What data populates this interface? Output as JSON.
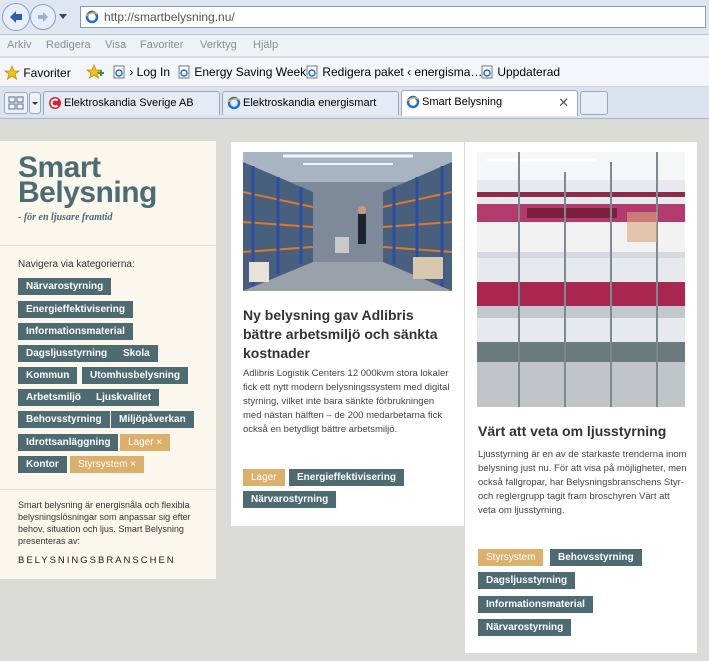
{
  "browser": {
    "url": "http://smartbelysning.nu/",
    "menu": [
      "Arkiv",
      "Redigera",
      "Visa",
      "Favoriter",
      "Verktyg",
      "Hjälp"
    ],
    "favorites_label": "Favoriter",
    "fav_links": [
      "› Log In",
      "Energy Saving Week",
      "Redigera paket ‹ energisma…",
      "Uppdaterad"
    ],
    "tabs": [
      {
        "label": "Elektroskandia Sverige AB",
        "active": false
      },
      {
        "label": "Elektroskandia energismart",
        "active": false
      },
      {
        "label": "Smart Belysning",
        "active": true
      }
    ]
  },
  "sidebar": {
    "logo_line1": "Smart",
    "logo_line2": "Belysning",
    "tagline": "- för en ljusare framtid",
    "nav_label": "Navigera via kategorierna:",
    "categories": [
      {
        "label": "Närvarostyrning",
        "selected": false
      },
      {
        "label": "Energieffektivisering",
        "selected": false
      },
      {
        "label": "Informationsmaterial",
        "selected": false
      },
      {
        "label": "Dagsljusstyrning",
        "selected": false
      },
      {
        "label": "Skola",
        "selected": false
      },
      {
        "label": "Kommun",
        "selected": false
      },
      {
        "label": "Utomhusbelysning",
        "selected": false
      },
      {
        "label": "Arbetsmiljö",
        "selected": false
      },
      {
        "label": "Ljuskvalitet",
        "selected": false
      },
      {
        "label": "Behovsstyrning",
        "selected": false
      },
      {
        "label": "Miljöpåverkan",
        "selected": false
      },
      {
        "label": "Idrottsanläggning",
        "selected": false
      },
      {
        "label": "Lager ×",
        "selected": true
      },
      {
        "label": "Kontor",
        "selected": false
      },
      {
        "label": "Styrsystem ×",
        "selected": true
      }
    ],
    "about_text": "Smart belysning är energisnåla och flexibla belysningslösningar som anpassar sig efter behov, situation och ljus. Smart Belysning presenteras av:",
    "presenter": "BELYSNINGSBRANSCHEN"
  },
  "articles": [
    {
      "title": "Ny belysning gav Adlibris bättre arbetsmiljö och sänkta kostnader",
      "excerpt": "Adlibris Logistik Centers 12 000kvm stora lokaler fick ett nytt modern belysningssystem med digital styrning, vilket inte bara sänkte förbrukningen med nästan hälften – de 200 medarbetarna fick också en betydligt bättre arbetsmiljö.",
      "tags": [
        {
          "label": "Lager",
          "highlight": true
        },
        {
          "label": "Energieffektivisering",
          "highlight": false
        },
        {
          "label": "Närvarostyrning",
          "highlight": false
        }
      ]
    },
    {
      "title": "Värt att veta om ljusstyrning",
      "excerpt": "Ljusstyrning är en av de starkaste trenderna inom belysning just nu. För att visa på möjligheter, men också fallgropar, har Belysningsbranschens Styr- och reglergrupp tagit fram broschyren Värt att veta om ljusstyrning.",
      "tags": [
        {
          "label": "Styrsystem",
          "highlight": true
        },
        {
          "label": "Behovsstyrning",
          "highlight": false
        },
        {
          "label": "Dagsljusstyrning",
          "highlight": false
        },
        {
          "label": "Informationsmaterial",
          "highlight": false
        },
        {
          "label": "Närvarostyrning",
          "highlight": false
        }
      ]
    }
  ]
}
